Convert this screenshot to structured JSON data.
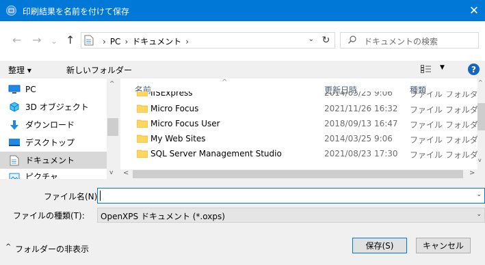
{
  "window": {
    "title": "印刷結果を名前を付けて保存",
    "close_glyph": "✕",
    "accent_color": "#0078d7"
  },
  "nav": {
    "back_glyph": "←",
    "forward_glyph": "→",
    "history_glyph": "⌄",
    "up_glyph": "↑",
    "breadcrumb": [
      "PC",
      "ドキュメント"
    ],
    "breadcrumb_sep": "›",
    "dropdown_glyph": "⌄",
    "refresh_glyph": "↻",
    "search_placeholder": "ドキュメントの検索"
  },
  "toolbar": {
    "organize_label": "整理 ▾",
    "new_folder_label": "新しいフォルダー",
    "view_dropdown_glyph": "▼",
    "help_label": "?"
  },
  "sidebar": {
    "items": [
      {
        "label": "PC",
        "icon": "pc-icon",
        "selected": false
      },
      {
        "label": "3D オブジェクト",
        "icon": "cube-icon",
        "selected": false
      },
      {
        "label": "ダウンロード",
        "icon": "download-icon",
        "selected": false
      },
      {
        "label": "デスクトップ",
        "icon": "desktop-icon",
        "selected": false
      },
      {
        "label": "ドキュメント",
        "icon": "document-icon",
        "selected": true
      },
      {
        "label": "ピクチャ",
        "icon": "picture-icon",
        "selected": false
      }
    ],
    "scroll_up_glyph": "^",
    "scroll_down_glyph": "v"
  },
  "filelist": {
    "columns": {
      "name": "名前",
      "date": "更新日時",
      "type": "種類"
    },
    "sort_glyph": "^",
    "rows": [
      {
        "name": "IISExpress",
        "date": "2014/03/25 9:06",
        "type": "ファイル フォルダー"
      },
      {
        "name": "Micro Focus",
        "date": "2021/11/26 16:32",
        "type": "ファイル フォルダー"
      },
      {
        "name": "Micro Focus User",
        "date": "2018/09/13 16:47",
        "type": "ファイル フォルダー"
      },
      {
        "name": "My Web Sites",
        "date": "2014/03/25 9:06",
        "type": "ファイル フォルダー"
      },
      {
        "name": "SQL Server Management Studio",
        "date": "2021/08/23 17:30",
        "type": "ファイル フォルダー"
      }
    ],
    "scroll_left_glyph": "<",
    "scroll_right_glyph": ">",
    "scroll_up_glyph": "^",
    "scroll_down_glyph": "v"
  },
  "form": {
    "filename_label": "ファイル名(N):",
    "filename_value": "",
    "filetype_label": "ファイルの種類(T):",
    "filetype_value": "OpenXPS ドキュメント (*.oxps)",
    "dropdown_glyph": "⌄"
  },
  "footer": {
    "hide_folders_label": "フォルダーの非表示",
    "hide_folders_glyph": "^",
    "save_label": "保存(S)",
    "cancel_label": "キャンセル"
  }
}
